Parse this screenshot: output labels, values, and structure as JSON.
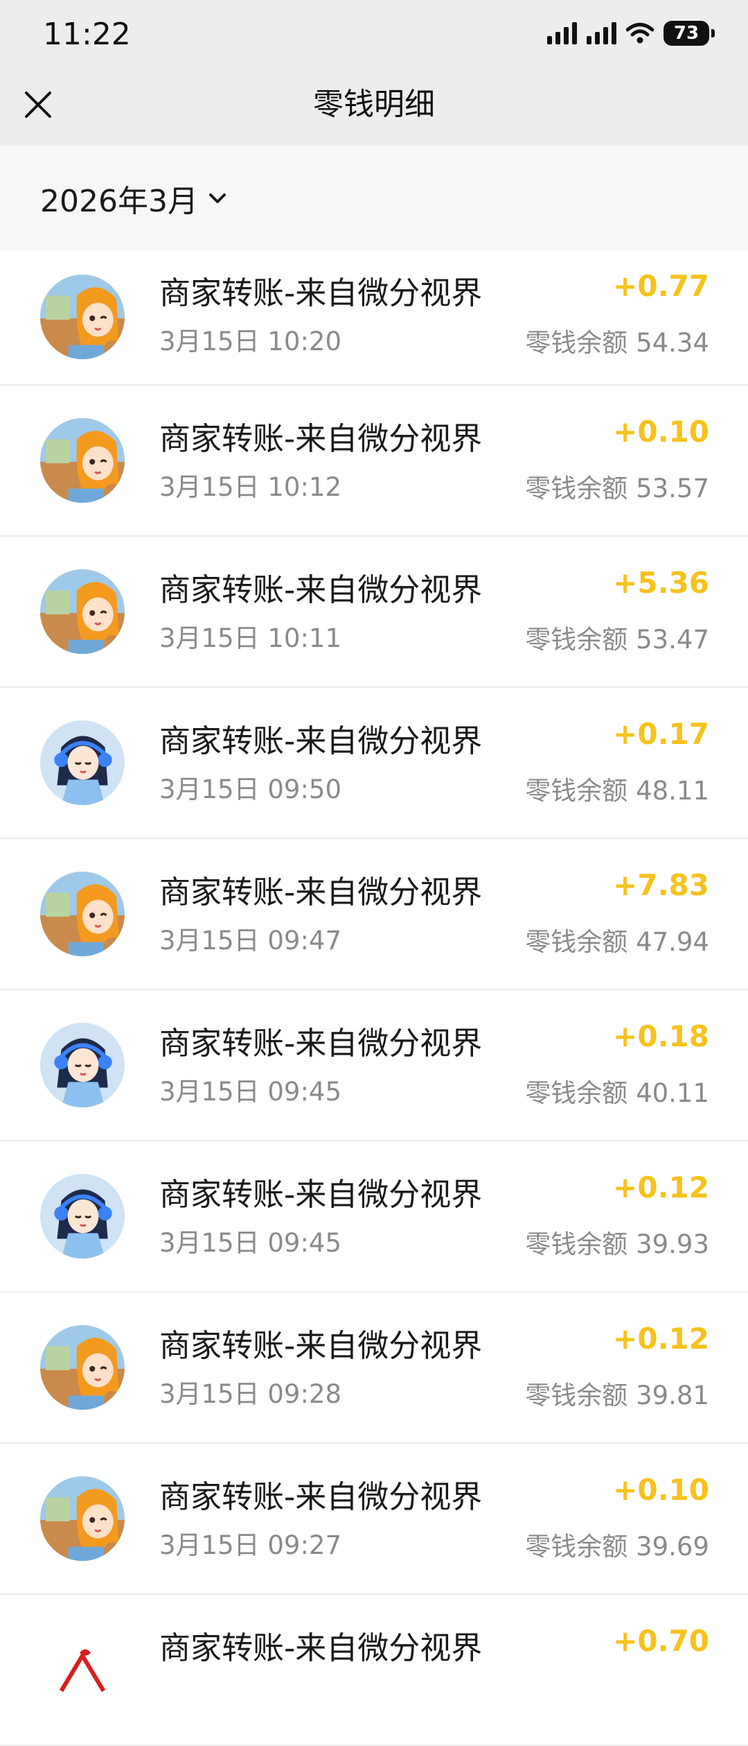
{
  "status_bar": {
    "time": "11:22",
    "battery": "73"
  },
  "nav": {
    "title": "零钱明细"
  },
  "month_filter": {
    "label": "2026年3月"
  },
  "colors": {
    "amount_positive": "#f6c21b",
    "secondary_text": "#8a8a8a"
  },
  "transactions": [
    {
      "title": "商家转账-来自微分视界",
      "time": "3月15日 10:20",
      "amount": "+0.77",
      "balance": "零钱余额 54.34",
      "avatar": "anime-girl-orange-avatar"
    },
    {
      "title": "商家转账-来自微分视界",
      "time": "3月15日 10:12",
      "amount": "+0.10",
      "balance": "零钱余额 53.57",
      "avatar": "anime-girl-orange-avatar"
    },
    {
      "title": "商家转账-来自微分视界",
      "time": "3月15日 10:11",
      "amount": "+5.36",
      "balance": "零钱余额 53.47",
      "avatar": "anime-girl-orange-avatar"
    },
    {
      "title": "商家转账-来自微分视界",
      "time": "3月15日 09:50",
      "amount": "+0.17",
      "balance": "零钱余额 48.11",
      "avatar": "anime-girl-blue-avatar"
    },
    {
      "title": "商家转账-来自微分视界",
      "time": "3月15日 09:47",
      "amount": "+7.83",
      "balance": "零钱余额 47.94",
      "avatar": "anime-girl-orange-avatar"
    },
    {
      "title": "商家转账-来自微分视界",
      "time": "3月15日 09:45",
      "amount": "+0.18",
      "balance": "零钱余额 40.11",
      "avatar": "anime-girl-blue-avatar"
    },
    {
      "title": "商家转账-来自微分视界",
      "time": "3月15日 09:45",
      "amount": "+0.12",
      "balance": "零钱余额 39.93",
      "avatar": "anime-girl-blue-avatar"
    },
    {
      "title": "商家转账-来自微分视界",
      "time": "3月15日 09:28",
      "amount": "+0.12",
      "balance": "零钱余额 39.81",
      "avatar": "anime-girl-orange-avatar"
    },
    {
      "title": "商家转账-来自微分视界",
      "time": "3月15日 09:27",
      "amount": "+0.10",
      "balance": "零钱余额 39.69",
      "avatar": "anime-girl-orange-avatar"
    },
    {
      "title": "商家转账-来自微分视界",
      "time": "",
      "amount": "+0.70",
      "balance": "",
      "avatar": "red-logo-avatar"
    }
  ]
}
